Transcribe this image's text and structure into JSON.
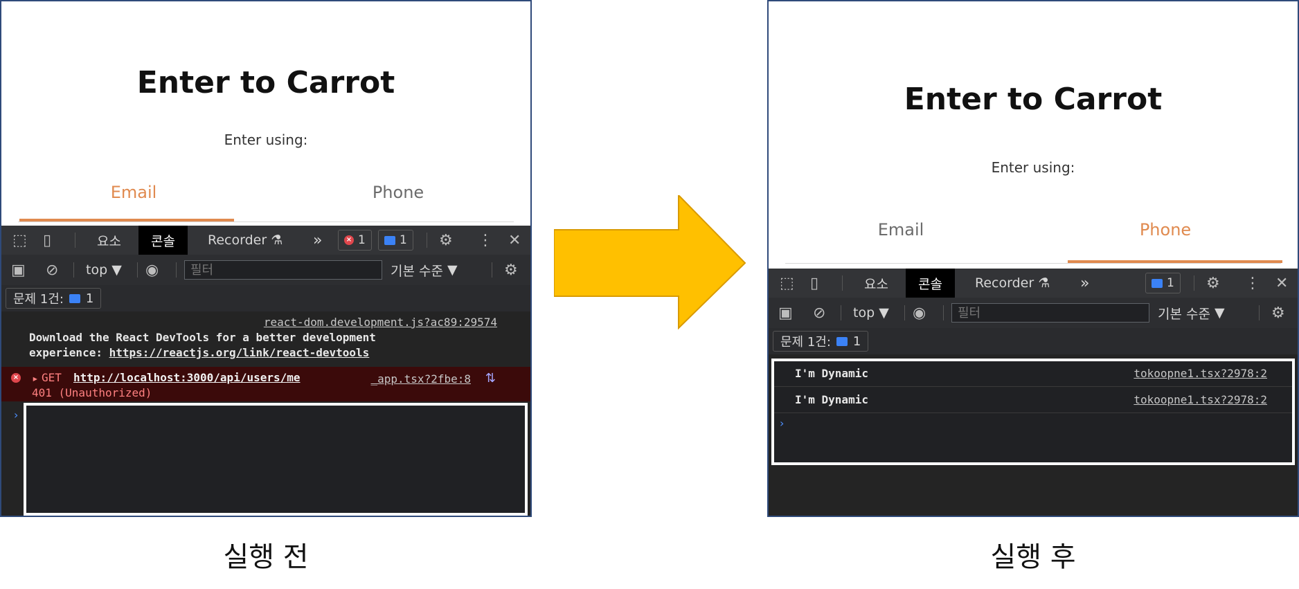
{
  "before": {
    "title": "Enter to Carrot",
    "subtitle": "Enter using:",
    "tabs": [
      {
        "label": "Email",
        "active": true
      },
      {
        "label": "Phone",
        "active": false
      }
    ],
    "devtools": {
      "tabs": [
        "요소",
        "콘솔",
        "Recorder"
      ],
      "active_tab": "콘솔",
      "overflow": "»",
      "error_count": "1",
      "message_count": "1",
      "context": "top",
      "filter_placeholder": "필터",
      "level": "기본 수준",
      "issues_label": "문제 1건:",
      "issues_count": "1",
      "logs": {
        "source1": "react-dom.development.js?ac89:29574",
        "line1": "Download the React DevTools for a better development",
        "line2_prefix": "experience:",
        "line2_link": "https://reactjs.org/link/react-devtools",
        "err_method": "GET",
        "err_url": "http://localhost:3000/api/users/me",
        "err_source": "_app.tsx?2fbe:8",
        "err_status": "401 (Unauthorized)"
      }
    },
    "caption": "실행 전"
  },
  "after": {
    "title": "Enter to Carrot",
    "subtitle": "Enter using:",
    "tabs": [
      {
        "label": "Email",
        "active": false
      },
      {
        "label": "Phone",
        "active": true
      }
    ],
    "devtools": {
      "tabs": [
        "요소",
        "콘솔",
        "Recorder"
      ],
      "active_tab": "콘솔",
      "overflow": "»",
      "message_count": "1",
      "context": "top",
      "filter_placeholder": "필터",
      "level": "기본 수준",
      "issues_label": "문제 1건:",
      "issues_count": "1",
      "logs": [
        {
          "text": "I'm Dynamic",
          "source": "tokoopne1.tsx?2978:2"
        },
        {
          "text": "I'm Dynamic",
          "source": "tokoopne1.tsx?2978:2"
        }
      ]
    },
    "caption": "실행 후"
  },
  "colors": {
    "accent": "#e08a4f",
    "arrow": "#ffc000",
    "frame": "#2f4a7a",
    "devtools_bg": "#2b2b2b",
    "error_bg": "#3b0a0a"
  }
}
